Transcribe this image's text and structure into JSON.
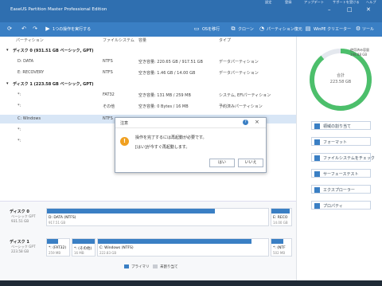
{
  "app": {
    "title": "EaseUS Partition Master Professional Edition"
  },
  "top_strip": [
    "設定",
    "登録",
    "アップデート",
    "サポートを受ける",
    "ヘルプ"
  ],
  "toolbar": {
    "pending_label": "1つの操作を実行する",
    "items": [
      "OSを移行",
      "クローン",
      "パーティション復元",
      "WinPE クリエーター",
      "ツール"
    ]
  },
  "columns": [
    "パーティション",
    "ファイルシステム",
    "容量",
    "タイプ"
  ],
  "rows": [
    {
      "name": "ディスク 0 (931.51 GB ベーシック, GPT)",
      "fs": "",
      "cap": "",
      "type": "",
      "disk": true
    },
    {
      "name": "D: DATA",
      "fs": "NTFS",
      "cap": "空き容量: 220.65 GB / 917.51 GB",
      "type": "データパーティション"
    },
    {
      "name": "E: RECOVERY",
      "fs": "NTFS",
      "cap": "空き容量: 1.46 GB / 14.00 GB",
      "type": "データパーティション"
    },
    {
      "name": "ディスク 1 (223.58 GB ベーシック, GPT)",
      "fs": "",
      "cap": "",
      "type": "",
      "disk": true
    },
    {
      "name": "*:",
      "fs": "FAT32",
      "cap": "空き容量: 131 MB / 259 MB",
      "type": "システム, EFIパーティション"
    },
    {
      "name": "*:",
      "fs": "その他",
      "cap": "空き容量: 0 Bytes / 16 MB",
      "type": "予約済みパーティション"
    },
    {
      "name": "C: Windows",
      "fs": "NTFS",
      "cap": "",
      "type": ""
    },
    {
      "name": "*:",
      "fs": "",
      "cap": "",
      "type": ""
    },
    {
      "name": "*:",
      "fs": "",
      "cap": "",
      "type": ""
    }
  ],
  "gauge": {
    "label_top": "使用済み容量",
    "top_value": "198.88 GB",
    "center_label": "合計",
    "center_value": "223.58 GB",
    "used_fraction": 0.89,
    "color": "#4cbf6b"
  },
  "side_buttons": [
    "領域の割り当て",
    "フォーマット",
    "ファイルシステムをチェック",
    "サーフェーステスト",
    "エクスプローラー",
    "プロパティ"
  ],
  "dialog": {
    "title": "注意",
    "message1": "操作を完了するには再起動が必要です。",
    "message2": "[はい]が今すぐ再起動します。",
    "yes": "はい",
    "no": "いいえ"
  },
  "disks_bottom": [
    {
      "name": "ディスク 0",
      "sub1": "ベーシック GPT",
      "sub2": "931.51 GB",
      "parts": [
        {
          "label": "D: DATA (NTFS)",
          "size": "917.51 GB",
          "used": 0.76
        },
        {
          "label": "E: RECO",
          "size": "14.00 GB",
          "used": 0.9
        }
      ]
    },
    {
      "name": "ディスク 1",
      "sub1": "ベーシック GPT",
      "sub2": "223.58 GB",
      "parts": [
        {
          "label": "*: (FAT32)",
          "size": "259 MB",
          "used": 0.5
        },
        {
          "label": "*: (その他)",
          "size": "16 MB",
          "used": 1.0
        },
        {
          "label": "C: Windows (NTFS)",
          "size": "222.83 GB",
          "used": 0.9
        },
        {
          "label": "*: (NTF",
          "size": "502 MB",
          "used": 0.6
        }
      ]
    }
  ],
  "legend": {
    "primary": "プライマリ",
    "unallocated": "未割り当て"
  }
}
